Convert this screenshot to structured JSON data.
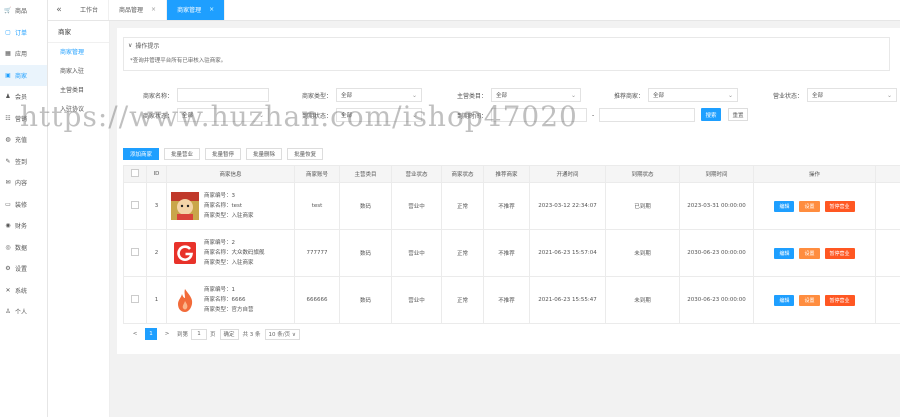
{
  "nav": [
    {
      "icon": "🛒",
      "label": "商品"
    },
    {
      "icon": "▢",
      "label": "订单"
    },
    {
      "icon": "▦",
      "label": "应用"
    },
    {
      "icon": "▣",
      "label": "商家"
    },
    {
      "icon": "♟",
      "label": "会员"
    },
    {
      "icon": "☷",
      "label": "营销"
    },
    {
      "icon": "◍",
      "label": "充值"
    },
    {
      "icon": "✎",
      "label": "签到"
    },
    {
      "icon": "✉",
      "label": "内容"
    },
    {
      "icon": "▭",
      "label": "装修"
    },
    {
      "icon": "◉",
      "label": "财务"
    },
    {
      "icon": "◎",
      "label": "数据"
    },
    {
      "icon": "⚙",
      "label": "设置"
    },
    {
      "icon": "✕",
      "label": "系统"
    },
    {
      "icon": "♙",
      "label": "个人"
    }
  ],
  "subnav": {
    "title": "商家",
    "items": [
      "商家管理",
      "商家入驻",
      "主营类目",
      "入驻协议"
    ]
  },
  "tabs": [
    {
      "label": "工作台"
    },
    {
      "label": "商品管理",
      "close": "×"
    },
    {
      "label": "商家管理",
      "close": "×"
    }
  ],
  "collapse_icon": "«",
  "tips": {
    "title": "操作提示",
    "chevron": "∨",
    "text": "*查询并管理平台所有已审核入驻商家。"
  },
  "filters": {
    "name_label": "商家名称：",
    "type_label": "商家类型：",
    "type_value": "全部",
    "category_label": "主营类目：",
    "category_value": "全部",
    "recommend_label": "推荐商家：",
    "recommend_value": "全部",
    "business_label": "营业状态：",
    "business_value": "全部",
    "status_label": "商家状态：",
    "status_value": "全部",
    "expire_label": "到期状态：",
    "expire_value": "全部",
    "expire_time_label": "到期时间：",
    "dash": "-",
    "search": "搜索",
    "reset": "重置"
  },
  "toolbar": [
    "添加商家",
    "批量营业",
    "批量暂停",
    "批量删除",
    "批量恢复"
  ],
  "table": {
    "headers": [
      "ID",
      "商家信息",
      "商家账号",
      "主营类目",
      "营业状态",
      "商家状态",
      "推荐商家",
      "开通时间",
      "到期状态",
      "到期时间",
      "操作"
    ],
    "rows": [
      {
        "id": "3",
        "line1": "商家编号：3",
        "line2": "商家名称：test",
        "line3": "商家类型：入驻商家",
        "account": "test",
        "category": "数码",
        "business": "营业中",
        "status": "正常",
        "recommend": "不推荐",
        "open_time": "2023-03-12 22:34:07",
        "expire_status": "已到期",
        "expire_time": "2023-03-31 00:00:00"
      },
      {
        "id": "2",
        "line1": "商家编号：2",
        "line2": "商家名称：大众数码旗舰",
        "line3": "商家类型：入驻商家",
        "account": "777777",
        "category": "数码",
        "business": "营业中",
        "status": "正常",
        "recommend": "不推荐",
        "open_time": "2021-06-23 15:57:04",
        "expire_status": "未到期",
        "expire_time": "2030-06-23 00:00:00"
      },
      {
        "id": "1",
        "line1": "商家编号：1",
        "line2": "商家名称：6666",
        "line3": "商家类型：官方自营",
        "account": "666666",
        "category": "数码",
        "business": "营业中",
        "status": "正常",
        "recommend": "不推荐",
        "open_time": "2021-06-23 15:55:47",
        "expire_status": "未到期",
        "expire_time": "2030-06-23 00:00:00"
      }
    ],
    "ops": [
      "编辑",
      "设置",
      "暂停营业"
    ]
  },
  "pager": {
    "prev": "<",
    "current": "1",
    "next": ">",
    "goto": "到第",
    "page_val": "1",
    "page_unit": "页",
    "confirm": "确定",
    "total": "共 3 条",
    "per_page": "10 条/页 ∨"
  },
  "watermark": "https://www.huzhan.com/ishop47020",
  "colors": {
    "primary": "#1e9fff",
    "orange": "#ff8d3f",
    "red": "#ff5722"
  }
}
